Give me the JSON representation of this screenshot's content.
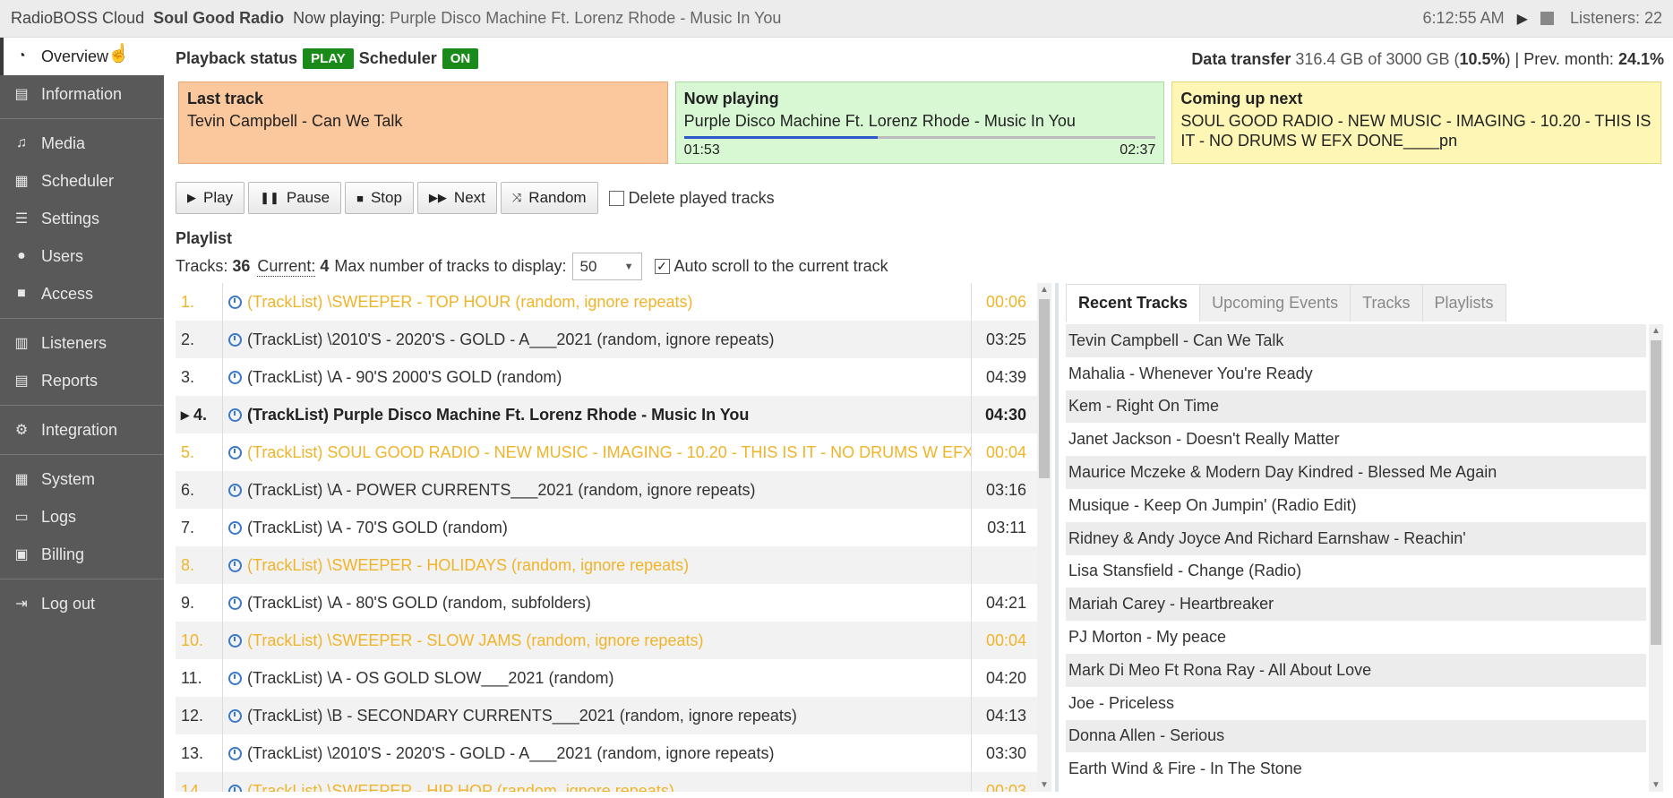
{
  "topbar": {
    "brand": "RadioBOSS Cloud",
    "station": "Soul Good Radio",
    "now_playing_label": "Now playing:",
    "now_playing_value": "Purple Disco Machine Ft. Lorenz Rhode - Music In You",
    "clock": "6:12:55 AM",
    "listeners": "Listeners: 22",
    "icons": [
      "play-icon",
      "stop-icon"
    ]
  },
  "sidebar": {
    "items": [
      {
        "label": "Overview",
        "icon": "dashboard-icon",
        "glyph": "◔",
        "active": true
      },
      {
        "label": "Information",
        "icon": "book-icon",
        "glyph": "▤"
      },
      {
        "label": "Media",
        "icon": "music-note-icon",
        "glyph": "♫"
      },
      {
        "label": "Scheduler",
        "icon": "calendar-icon",
        "glyph": "▦"
      },
      {
        "label": "Settings",
        "icon": "sliders-icon",
        "glyph": "☰"
      },
      {
        "label": "Users",
        "icon": "user-icon",
        "glyph": "●"
      },
      {
        "label": "Access",
        "icon": "lock-icon",
        "glyph": "■"
      },
      {
        "label": "Listeners",
        "icon": "bar-chart-icon",
        "glyph": "▥"
      },
      {
        "label": "Reports",
        "icon": "document-icon",
        "glyph": "▤"
      },
      {
        "label": "Integration",
        "icon": "gears-icon",
        "glyph": "⚙"
      },
      {
        "label": "System",
        "icon": "grid-icon",
        "glyph": "▦"
      },
      {
        "label": "Logs",
        "icon": "folder-icon",
        "glyph": "▭"
      },
      {
        "label": "Billing",
        "icon": "money-icon",
        "glyph": "▣"
      },
      {
        "label": "Log out",
        "icon": "logout-icon",
        "glyph": "⇥"
      }
    ]
  },
  "status": {
    "playback_label": "Playback status",
    "playback_value": "PLAY",
    "scheduler_label": "Scheduler",
    "scheduler_value": "ON",
    "transfer_label": "Data transfer",
    "transfer_value": "316.4 GB of 3000 GB (",
    "transfer_pct": "10.5%",
    "transfer_prev_label": ") | Prev. month:",
    "transfer_prev": "24.1%",
    "badge_color": "#1a8a1a"
  },
  "cards": {
    "last": {
      "title": "Last track",
      "body": "Tevin Campbell - Can We Talk"
    },
    "now": {
      "title": "Now playing",
      "body": "Purple Disco Machine Ft. Lorenz Rhode - Music In You",
      "elapsed": "01:53",
      "total": "02:37",
      "progress": 0.41
    },
    "next": {
      "title": "Coming up next",
      "body": "SOUL GOOD RADIO - NEW MUSIC - IMAGING - 10.20 - THIS IS IT - NO DRUMS W EFX DONE____pn"
    }
  },
  "controls": {
    "play": "Play",
    "pause": "Pause",
    "stop": "Stop",
    "next": "Next",
    "random": "Random",
    "delete_played": "Delete played tracks"
  },
  "playlist": {
    "title": "Playlist",
    "tracks_label": "Tracks:",
    "tracks_count": "36",
    "current_label": "Current:",
    "current_value": "4",
    "max_label": "Max number of tracks to display:",
    "max_value": "50",
    "autoscroll_label": "Auto scroll to the current track",
    "rows": [
      {
        "num": "1.",
        "name": "(TrackList) \\SWEEPER - TOP HOUR (random, ignore repeats)",
        "dur": "00:06",
        "style": "yellow"
      },
      {
        "num": "2.",
        "name": "(TrackList) \\2010'S - 2020'S - GOLD - A___2021 (random, ignore repeats)",
        "dur": "03:25",
        "style": ""
      },
      {
        "num": "3.",
        "name": "(TrackList) \\A - 90'S 2000'S GOLD (random)",
        "dur": "04:39",
        "style": ""
      },
      {
        "num": "▸ 4.",
        "name": "(TrackList) Purple Disco Machine Ft. Lorenz Rhode - Music In You",
        "dur": "04:30",
        "style": "current"
      },
      {
        "num": "5.",
        "name": "(TrackList) SOUL GOOD RADIO - NEW MUSIC - IMAGING - 10.20 - THIS IS IT - NO DRUMS W EFX DONE____pn",
        "dur": "00:04",
        "style": "yellow"
      },
      {
        "num": "6.",
        "name": "(TrackList) \\A - POWER CURRENTS___2021 (random, ignore repeats)",
        "dur": "03:16",
        "style": ""
      },
      {
        "num": "7.",
        "name": "(TrackList) \\A - 70'S GOLD (random)",
        "dur": "03:11",
        "style": ""
      },
      {
        "num": "8.",
        "name": "(TrackList) \\SWEEPER - HOLIDAYS (random, ignore repeats)",
        "dur": "",
        "style": "yellow"
      },
      {
        "num": "9.",
        "name": "(TrackList) \\A - 80'S GOLD (random, subfolders)",
        "dur": "04:21",
        "style": ""
      },
      {
        "num": "10.",
        "name": "(TrackList) \\SWEEPER - SLOW JAMS (random, ignore repeats)",
        "dur": "00:04",
        "style": "yellow"
      },
      {
        "num": "11.",
        "name": "(TrackList) \\A - OS GOLD SLOW___2021 (random)",
        "dur": "04:20",
        "style": ""
      },
      {
        "num": "12.",
        "name": "(TrackList) \\B - SECONDARY CURRENTS___2021 (random, ignore repeats)",
        "dur": "04:13",
        "style": ""
      },
      {
        "num": "13.",
        "name": "(TrackList) \\2010'S - 2020'S - GOLD - A___2021 (random, ignore repeats)",
        "dur": "03:30",
        "style": ""
      },
      {
        "num": "14.",
        "name": "(TrackList) \\SWEEPER - HIP HOP (random, ignore repeats)",
        "dur": "00:03",
        "style": "yellow"
      }
    ]
  },
  "tabs": [
    "Recent Tracks",
    "Upcoming Events",
    "Tracks",
    "Playlists"
  ],
  "recent_tracks": [
    "Tevin Campbell - Can We Talk",
    "Mahalia - Whenever You're Ready",
    "Kem - Right On Time",
    "Janet Jackson - Doesn't Really Matter",
    "Maurice Mczeke & Modern Day Kindred - Blessed Me Again",
    "Musique - Keep On Jumpin' (Radio Edit)",
    "Ridney & Andy Joyce And Richard Earnshaw - Reachin'",
    "Lisa Stansfield - Change (Radio)",
    "Mariah Carey - Heartbreaker",
    "PJ Morton - My peace",
    "Mark Di Meo Ft Rona Ray - All About Love",
    "Joe - Priceless",
    "Donna Allen - Serious",
    "Earth Wind & Fire - In The Stone"
  ]
}
